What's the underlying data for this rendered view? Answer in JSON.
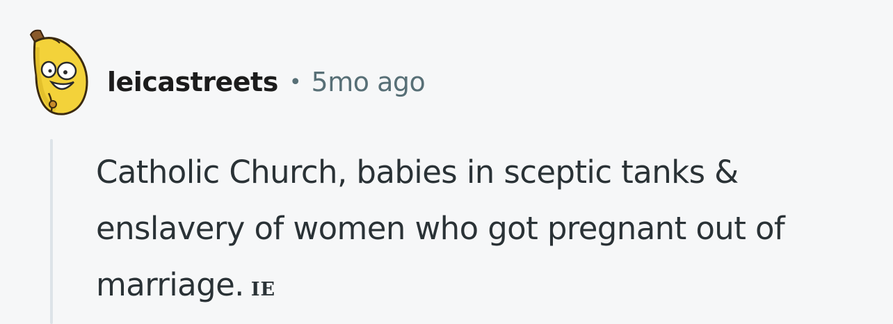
{
  "comment": {
    "avatar_icon": "banana-avatar-icon",
    "username": "leicastreets",
    "separator": "•",
    "timestamp": "5mo ago",
    "body": "Catholic Church, babies in sceptic tanks & enslavery of women who got pregnant out of marriage.",
    "flair": "IE"
  },
  "colors": {
    "background": "#f6f7f8",
    "username": "#1c1c1c",
    "meta": "#576f76",
    "body": "#2a3236",
    "thread_line": "#dde3e8",
    "avatar_yellow": "#f3d23a"
  }
}
